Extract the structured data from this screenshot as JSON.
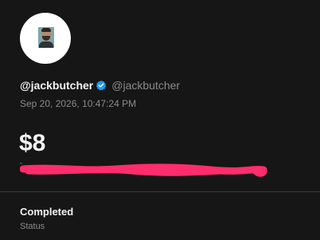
{
  "profile": {
    "display_name": "@jackbutcher",
    "handle": "@jackbutcher",
    "verified": true,
    "verified_color": "#1d9bf0"
  },
  "transaction": {
    "timestamp": "Sep 20, 2026, 10:47:24 PM",
    "amount": "$8",
    "redaction_color": "#ff2d6b"
  },
  "status": {
    "value": "Completed",
    "label": "Status"
  }
}
